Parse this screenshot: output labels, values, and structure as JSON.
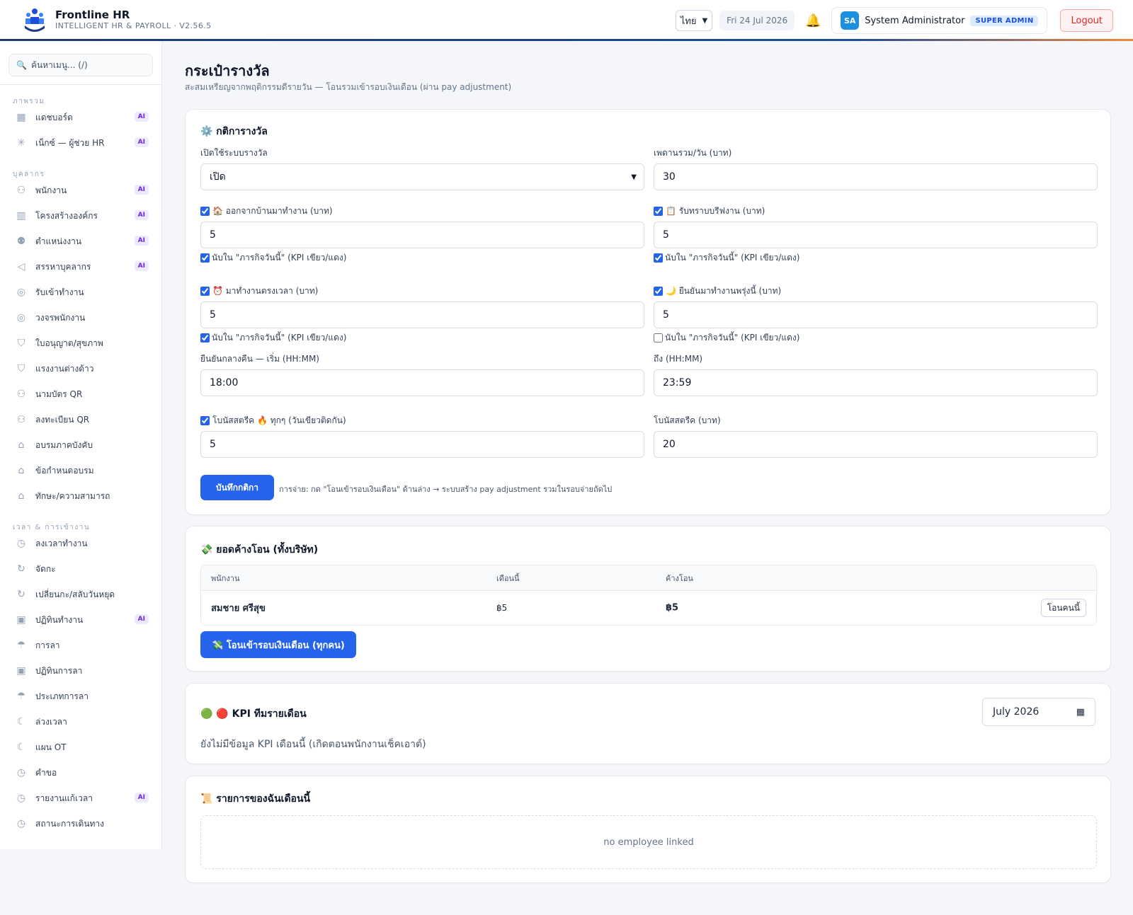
{
  "header": {
    "app_name": "Frontline HR",
    "app_subtitle": "INTELLIGENT HR & PAYROLL · V2.56.5",
    "lang_value": "ไทย",
    "date": "Fri 24 Jul 2026",
    "avatar_initials": "SA",
    "user_name": "System Administrator",
    "user_role": "SUPER ADMIN",
    "logout_label": "Logout"
  },
  "sidebar": {
    "search_placeholder": "ค้นหาเมนู... (/)",
    "ai_badge": "AI",
    "sections": [
      {
        "title": "ภาพรวม",
        "items": [
          {
            "label": "แดชบอร์ด",
            "icon": "grid-icon",
            "ai": true
          },
          {
            "label": "เน็กซ์ — ผู้ช่วย HR",
            "icon": "sparkle-icon",
            "ai": true
          }
        ]
      },
      {
        "title": "บุคลากร",
        "items": [
          {
            "label": "พนักงาน",
            "icon": "users-icon",
            "ai": true
          },
          {
            "label": "โครงสร้างองค์กร",
            "icon": "building-icon",
            "ai": true
          },
          {
            "label": "ตำแหน่งงาน",
            "icon": "org-chart-icon",
            "ai": true
          },
          {
            "label": "สรรหาบุคลากร",
            "icon": "megaphone-icon",
            "ai": true
          },
          {
            "label": "รับเข้าทำงาน",
            "icon": "compass-icon",
            "ai": false
          },
          {
            "label": "วงจรพนักงาน",
            "icon": "compass-icon",
            "ai": false
          },
          {
            "label": "ใบอนุญาต/สุขภาพ",
            "icon": "shield-icon",
            "ai": false
          },
          {
            "label": "แรงงานต่างด้าว",
            "icon": "shield-icon",
            "ai": false
          },
          {
            "label": "นามบัตร QR",
            "icon": "users-icon",
            "ai": false
          },
          {
            "label": "ลงทะเบียน QR",
            "icon": "users-icon",
            "ai": false
          },
          {
            "label": "อบรมภาคบังคับ",
            "icon": "graduation-cap-icon",
            "ai": false
          },
          {
            "label": "ข้อกำหนดอบรม",
            "icon": "graduation-cap-icon",
            "ai": false
          },
          {
            "label": "ทักษะ/ความสามารถ",
            "icon": "graduation-cap-icon",
            "ai": false
          }
        ]
      },
      {
        "title": "เวลา & การเข้างาน",
        "items": [
          {
            "label": "ลงเวลาทำงาน",
            "icon": "clock-icon",
            "ai": false
          },
          {
            "label": "จัดกะ",
            "icon": "refresh-icon",
            "ai": false
          },
          {
            "label": "เปลี่ยนกะ/สลับวันหยุด",
            "icon": "refresh-icon",
            "ai": false
          },
          {
            "label": "ปฏิทินทำงาน",
            "icon": "calendar-icon",
            "ai": true
          },
          {
            "label": "การลา",
            "icon": "umbrella-icon",
            "ai": false
          },
          {
            "label": "ปฏิทินการลา",
            "icon": "calendar-icon",
            "ai": false
          },
          {
            "label": "ประเภทการลา",
            "icon": "umbrella-icon",
            "ai": false
          },
          {
            "label": "ล่วงเวลา",
            "icon": "moon-icon",
            "ai": false
          },
          {
            "label": "แผน OT",
            "icon": "moon-icon",
            "ai": false
          },
          {
            "label": "คำขอ",
            "icon": "clock-icon",
            "ai": false
          },
          {
            "label": "รายงานแก้เวลา",
            "icon": "clock-icon",
            "ai": true
          },
          {
            "label": "สถานะการเดินทาง",
            "icon": "clock-icon",
            "ai": false
          }
        ]
      }
    ]
  },
  "page": {
    "title": "กระเป๋ารางวัล",
    "subtitle": "สะสมเหรียญจากพฤติกรรมดีรายวัน — โอนรวมเข้ารอบเงินเดือน (ผ่าน pay adjustment)"
  },
  "rules": {
    "title": "⚙️ กติการางวัล",
    "enable_label": "เปิดใช้ระบบรางวัล",
    "enable_value": "เปิด",
    "cap_label": "เพดานรวม/วัน (บาท)",
    "cap_value": "30",
    "count_kpi_label": "นับใน \"ภารกิจวันนี้\" (KPI เขียว/แดง)",
    "leave_home_label": "🏠 ออกจากบ้านมาทำงาน (บาท)",
    "leave_home_value": "5",
    "briefing_label": "📋 รับทราบบรีฟงาน (บาท)",
    "briefing_value": "5",
    "ontime_label": "⏰ มาทำงานตรงเวลา (บาท)",
    "ontime_value": "5",
    "confirm_tomorrow_label": "🌙 ยืนยันมาทำงานพรุ่งนี้ (บาท)",
    "confirm_tomorrow_value": "5",
    "night_start_label": "ยืนยันกลางคืน — เริ่ม (HH:MM)",
    "night_start_value": "18:00",
    "night_end_label": "ถึง (HH:MM)",
    "night_end_value": "23:59",
    "streak_every_label": "โบนัสสตรีค 🔥 ทุกๆ (วันเขียวติดกัน)",
    "streak_every_value": "5",
    "streak_bonus_label": "โบนัสสตรีค (บาท)",
    "streak_bonus_value": "20",
    "save_label": "บันทึกกติกา",
    "note": "การจ่าย: กด \"โอนเข้ารอบเงินเดือน\" ด้านล่าง → ระบบสร้าง pay adjustment รวมในรอบจ่ายถัดไป"
  },
  "pending": {
    "title": "💸 ยอดค้างโอน (ทั้งบริษัท)",
    "columns": [
      "พนักงาน",
      "เดือนนี้",
      "ค้างโอน"
    ],
    "rows": [
      {
        "name": "สมชาย ศรีสุข",
        "month": "฿5",
        "pending": "฿5",
        "action": "โอนคนนี้"
      }
    ],
    "transfer_all_label": "💸 โอนเข้ารอบเงินเดือน (ทุกคน)"
  },
  "kpi": {
    "title": "🟢 🔴 KPI ทีมรายเดือน",
    "month_value": "July 2026",
    "empty": "ยังไม่มีข้อมูล KPI เดือนนี้ (เกิดตอนพนักงานเช็คเอาต์)"
  },
  "mine": {
    "title": "📜 รายการของฉันเดือนนี้",
    "empty": "no employee linked"
  }
}
